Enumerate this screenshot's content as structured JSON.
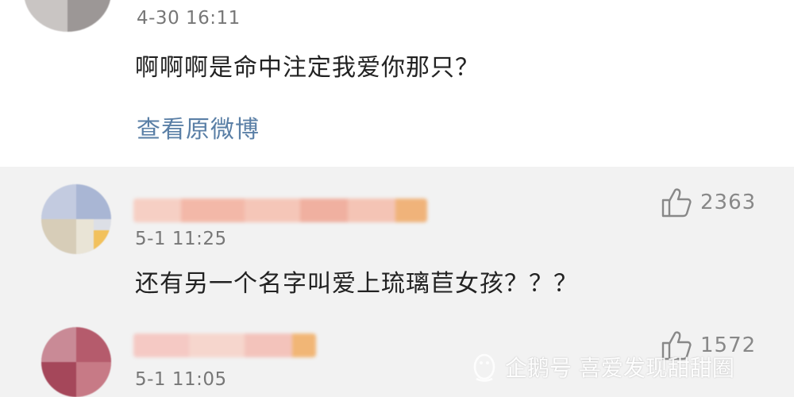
{
  "post": {
    "timestamp": "4-30 16:11",
    "text": "啊啊啊是命中注定我爱你那只？",
    "view_original_label": "查看原微博"
  },
  "replies": [
    {
      "timestamp": "5-1 11:25",
      "text": "还有另一个名字叫爱上琉璃苣女孩？？？",
      "like_count": "2363",
      "like_icon": "thumbs-up-icon"
    },
    {
      "timestamp": "5-1 11:05",
      "text": "",
      "like_count": "1572",
      "like_icon": "thumbs-up-icon"
    }
  ],
  "watermark": {
    "text": "企鹅号 喜爱发现甜甜圈",
    "icon": "penguin-icon"
  },
  "colors": {
    "link": "#5a7fa6",
    "reply_background": "#f2f2f2",
    "post_background": "#ffffff",
    "meta_text": "#777777"
  }
}
